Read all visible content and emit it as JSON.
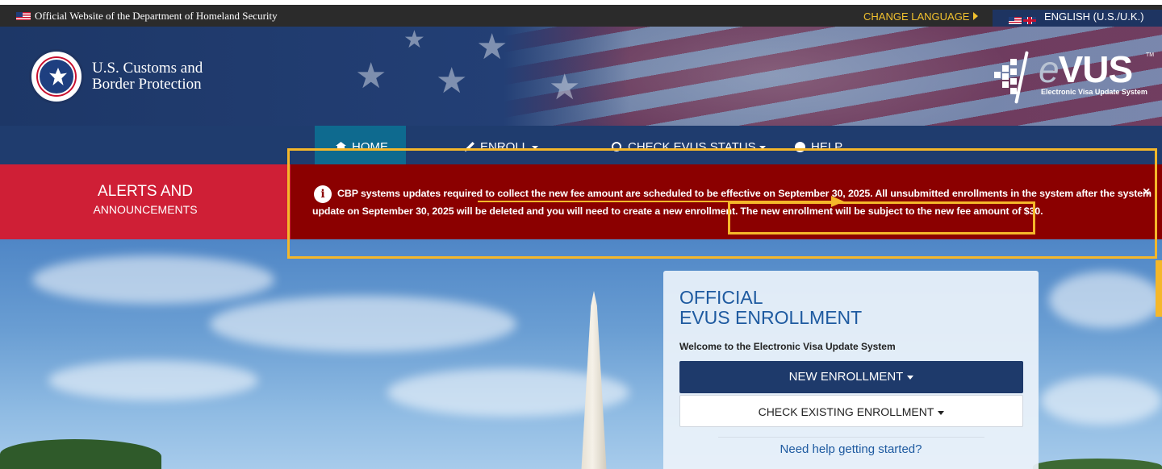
{
  "gov_bar": {
    "text": "Official Website of the Department of Homeland Security",
    "change_language": "CHANGE LANGUAGE",
    "current_language": "ENGLISH (U.S./U.K.)"
  },
  "header": {
    "agency_line1": "U.S. Customs and",
    "agency_line2": "Border Protection",
    "logo_word_e": "e",
    "logo_word_rest": "VUS",
    "logo_tm": "TM",
    "logo_subtitle": "Electronic Visa Update System"
  },
  "nav": {
    "items": [
      {
        "label": "HOME",
        "icon": "home-icon"
      },
      {
        "label": "ENROLL",
        "icon": "pencil-icon"
      },
      {
        "label": "CHECK EVUS STATUS",
        "icon": "search-icon"
      },
      {
        "label": "HELP",
        "icon": "help-icon"
      }
    ]
  },
  "alert": {
    "title": "ALERTS AND",
    "subtitle": "ANNOUNCEMENTS",
    "line1": "CBP systems updates required to collect the new fee amount are scheduled to be effective on September 30, 2025. All unsubmitted enrollments in the system after the system",
    "line2a": "update on September 30, 2025 will be deleted and you will need to create a new enrollment.",
    "line2b": "The new enrollment will be subject to the new fee amount of $30.",
    "close": "×"
  },
  "card": {
    "title_line1": "OFFICIAL",
    "title_line2": "EVUS ENROLLMENT",
    "welcome": "Welcome to the Electronic Visa Update System",
    "new_enrollment": "NEW ENROLLMENT",
    "check_existing": "CHECK EXISTING ENROLLMENT",
    "help_link": "Need help getting started?"
  },
  "colors": {
    "nav_bg": "#1f3c6e",
    "nav_active": "#0e6a8f",
    "alert_label_bg": "#cf1f36",
    "alert_body_bg": "#8b0000",
    "annotation": "#f5b72a",
    "primary_button": "#1e3a6b",
    "link": "#1e5aa0"
  }
}
